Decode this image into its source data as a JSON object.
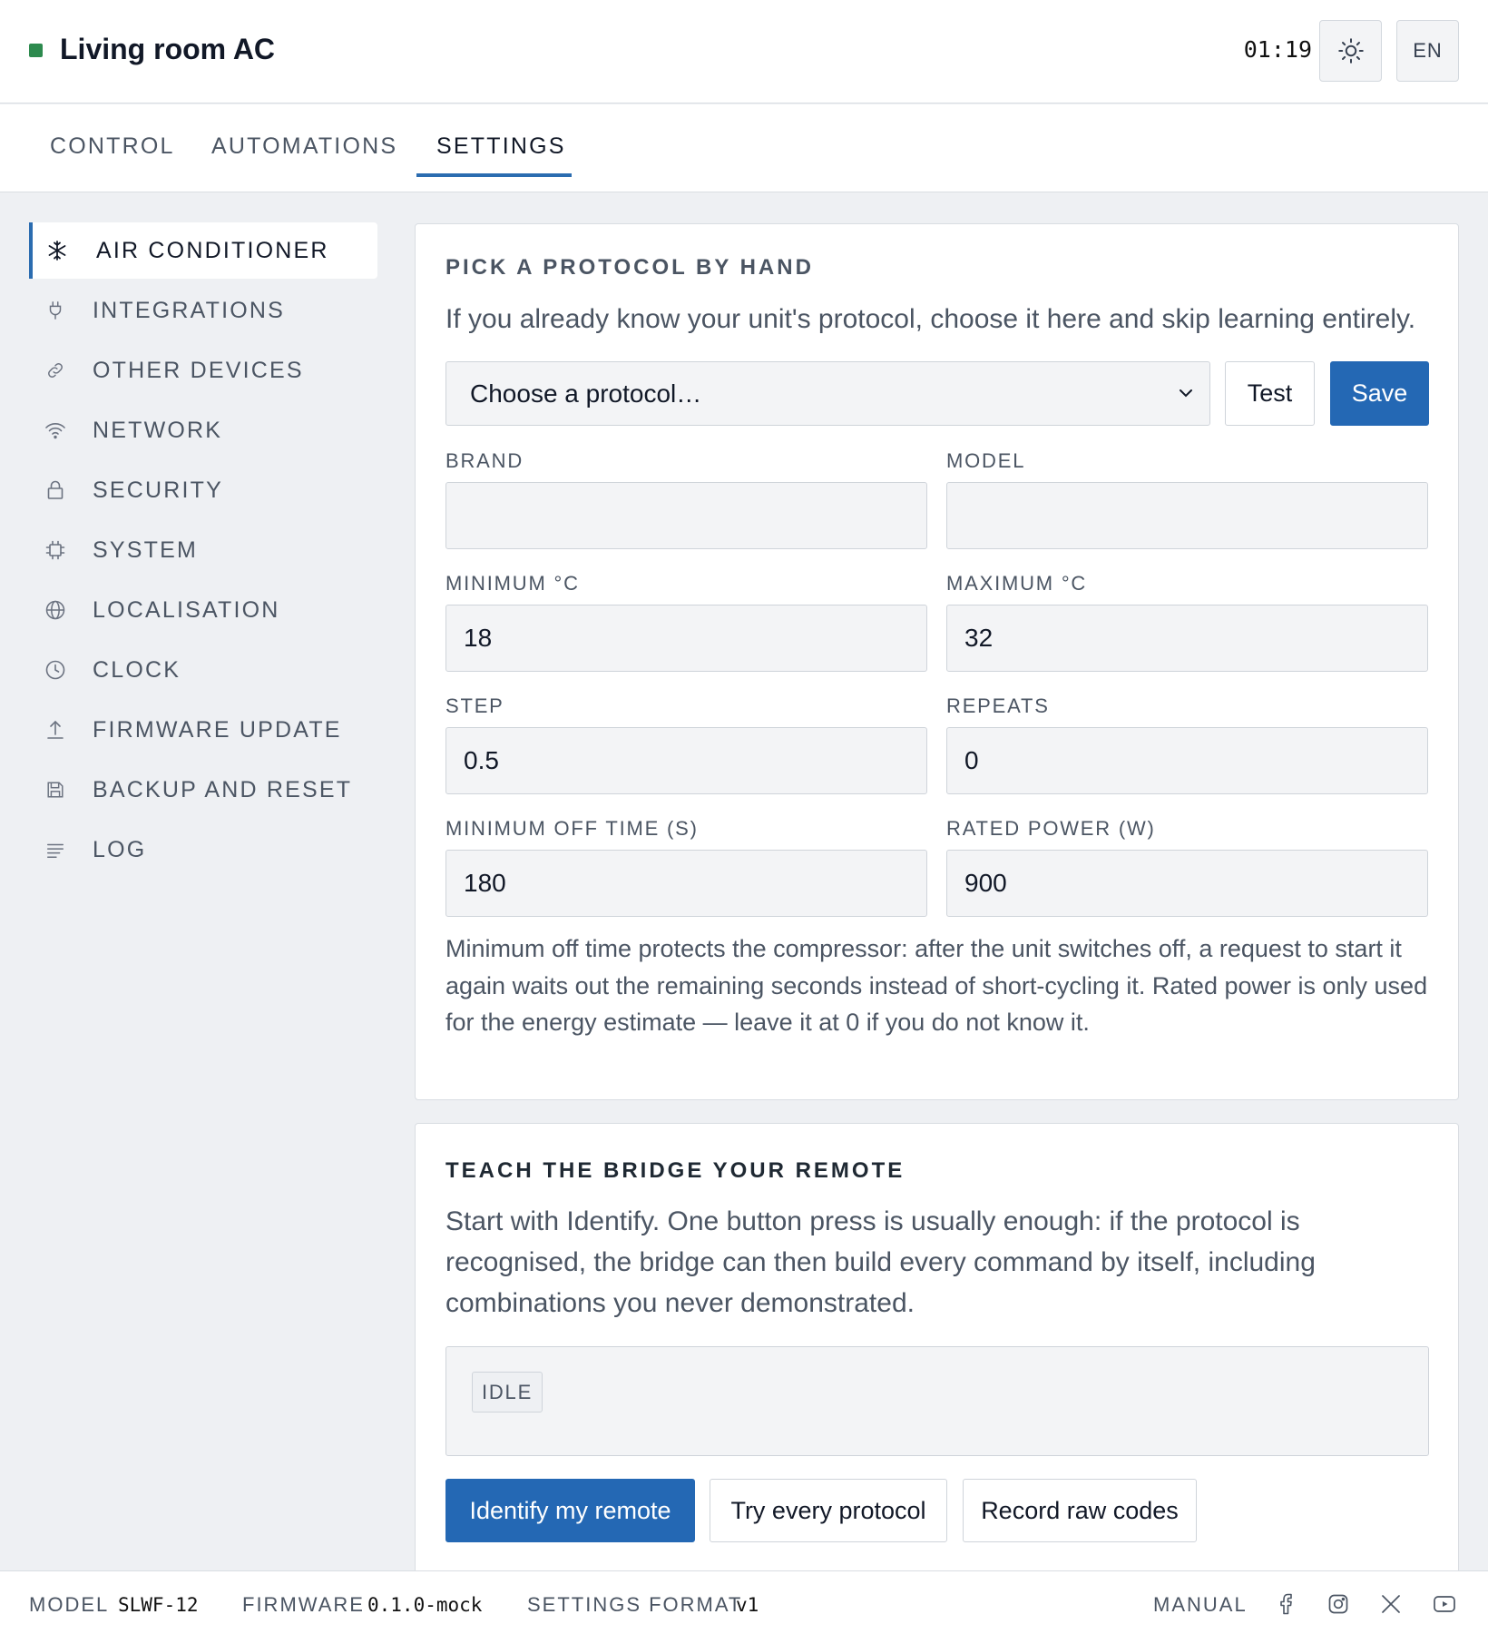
{
  "header": {
    "title": "Living room AC",
    "clock": "01:19",
    "theme_icon": "sun-icon",
    "language": "EN"
  },
  "tabs": [
    {
      "label": "CONTROL"
    },
    {
      "label": "AUTOMATIONS"
    },
    {
      "label": "SETTINGS",
      "active": true
    }
  ],
  "sidebar": {
    "items": [
      {
        "label": "AIR CONDITIONER",
        "icon": "snowflake-icon",
        "active": true
      },
      {
        "label": "INTEGRATIONS",
        "icon": "plug-icon"
      },
      {
        "label": "OTHER DEVICES",
        "icon": "link-icon"
      },
      {
        "label": "NETWORK",
        "icon": "wifi-icon"
      },
      {
        "label": "SECURITY",
        "icon": "lock-icon"
      },
      {
        "label": "SYSTEM",
        "icon": "chip-icon"
      },
      {
        "label": "LOCALISATION",
        "icon": "globe-icon"
      },
      {
        "label": "CLOCK",
        "icon": "clock-icon"
      },
      {
        "label": "FIRMWARE UPDATE",
        "icon": "upload-icon"
      },
      {
        "label": "BACKUP AND RESET",
        "icon": "floppy-icon"
      },
      {
        "label": "LOG",
        "icon": "lines-icon"
      }
    ]
  },
  "protocol_panel": {
    "title": "PICK A PROTOCOL BY HAND",
    "description": "If you already know your unit's protocol, choose it here and skip learning entirely.",
    "select_value": "Choose a protocol…",
    "test_label": "Test",
    "save_label": "Save",
    "fields": {
      "brand": {
        "label": "BRAND",
        "value": ""
      },
      "model": {
        "label": "MODEL",
        "value": ""
      },
      "min_c": {
        "label": "MINIMUM °C",
        "value": "18"
      },
      "max_c": {
        "label": "MAXIMUM °C",
        "value": "32"
      },
      "step": {
        "label": "STEP",
        "value": "0.5"
      },
      "repeats": {
        "label": "REPEATS",
        "value": "0"
      },
      "min_off": {
        "label": "MINIMUM OFF TIME (S)",
        "value": "180"
      },
      "rated_power": {
        "label": "RATED POWER (W)",
        "value": "900"
      }
    },
    "note": "Minimum off time protects the compressor: after the unit switches off, a request to start it again waits out the remaining seconds instead of short-cycling it. Rated power is only used for the energy estimate — leave it at 0 if you do not know it."
  },
  "teach_panel": {
    "title": "TEACH THE BRIDGE YOUR REMOTE",
    "description": "Start with Identify. One button press is usually enough: if the protocol is recognised, the bridge can then build every command by itself, including combinations you never demonstrated.",
    "status": "IDLE",
    "identify_label": "Identify my remote",
    "try_label": "Try every protocol",
    "record_label": "Record raw codes"
  },
  "footer": {
    "model_label": "MODEL",
    "model_value": "SLWF-12",
    "firmware_label": "FIRMWARE",
    "firmware_value": "0.1.0-mock",
    "format_label": "SETTINGS FORMAT",
    "format_value": "v1",
    "manual_label": "MANUAL",
    "social_icons": [
      "facebook-icon",
      "instagram-icon",
      "x-icon",
      "youtube-icon"
    ]
  },
  "colors": {
    "accent": "#2468b4",
    "status": "#2d8a4e"
  }
}
